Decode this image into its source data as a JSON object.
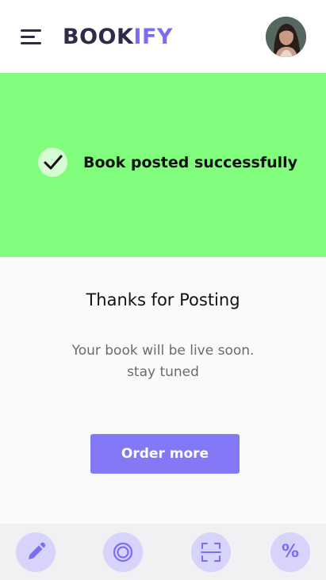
{
  "header": {
    "logo_part1": "BOOK",
    "logo_part2": "IFY",
    "menu_icon": "menu-icon",
    "avatar": "user-avatar"
  },
  "banner": {
    "message": "Book posted successfully",
    "icon": "check-icon",
    "color": "#80fd7c"
  },
  "content": {
    "title": "Thanks for Posting",
    "line1": "Your book will be live soon.",
    "line2": "stay tuned",
    "button_label": "Order more"
  },
  "bottom_nav": {
    "items": [
      {
        "icon": "pencil-icon"
      },
      {
        "icon": "target-icon"
      },
      {
        "icon": "scan-icon"
      },
      {
        "icon": "percent-icon",
        "label": "%"
      }
    ]
  },
  "colors": {
    "accent": "#7b6cf6",
    "button": "#8379f7",
    "nav_circle": "#d8d3fb",
    "dark": "#2f2a4a"
  }
}
